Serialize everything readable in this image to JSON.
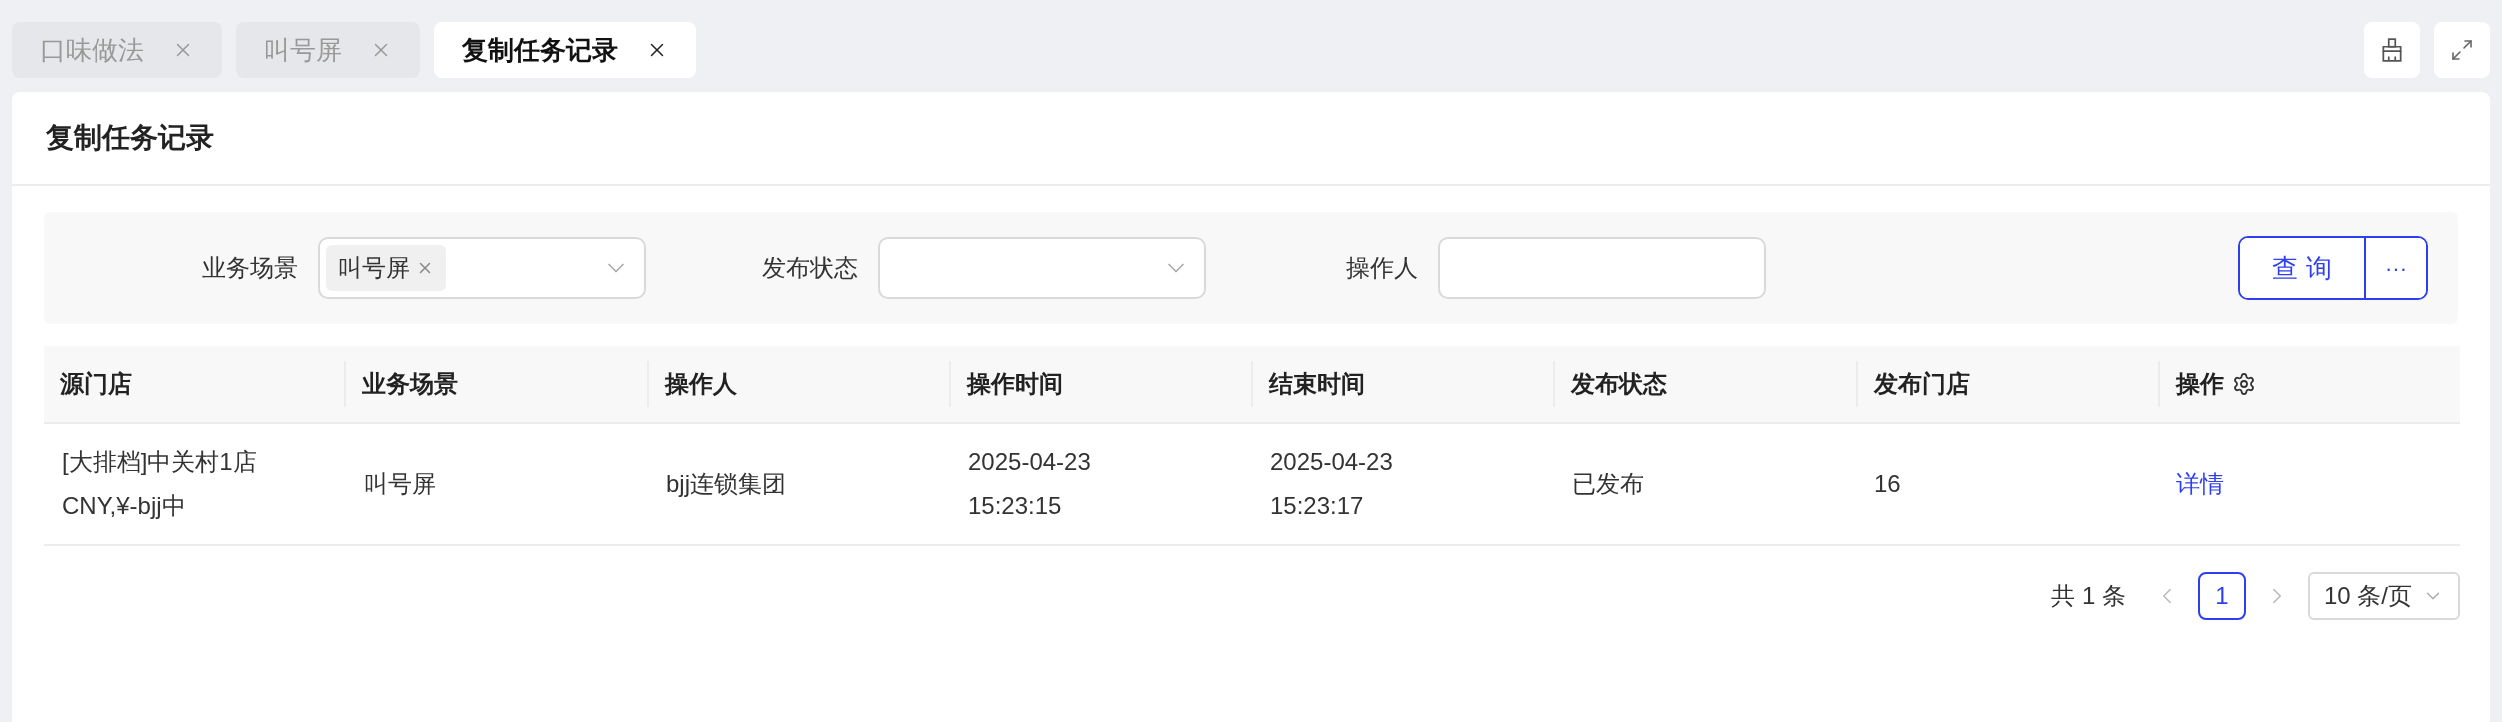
{
  "tabs": [
    {
      "label": "口味做法",
      "selected": false
    },
    {
      "label": "叫号屏",
      "selected": false
    },
    {
      "label": "复制任务记录",
      "selected": true
    }
  ],
  "page": {
    "title": "复制任务记录"
  },
  "filters": [
    {
      "kind": "tag-select",
      "label": "业务场景",
      "tags": [
        "叫号屏"
      ]
    },
    {
      "kind": "select",
      "label": "发布状态"
    },
    {
      "kind": "input",
      "label": "操作人"
    }
  ],
  "actions": {
    "query": "查 询",
    "more": "···"
  },
  "table": {
    "columns": [
      {
        "label": "源门店"
      },
      {
        "label": "业务场景"
      },
      {
        "label": "操作人"
      },
      {
        "label": "操作时间"
      },
      {
        "label": "结束时间"
      },
      {
        "label": "发布状态"
      },
      {
        "label": "发布门店"
      },
      {
        "label": "操作",
        "settings": true
      }
    ],
    "rows": [
      {
        "cells": [
          "[大排档]中关村1店\nCNY,¥-bjj中",
          "叫号屏",
          "bjj连锁集团",
          "2025-04-23\n15:23:15",
          "2025-04-23\n15:23:17",
          "已发布",
          "16",
          {
            "kind": "link",
            "text": "详情"
          }
        ]
      }
    ]
  },
  "pagination": {
    "total": "共 1 条",
    "pages": [
      {
        "label": "1",
        "selected": true
      }
    ],
    "page_size": "10 条/页"
  }
}
